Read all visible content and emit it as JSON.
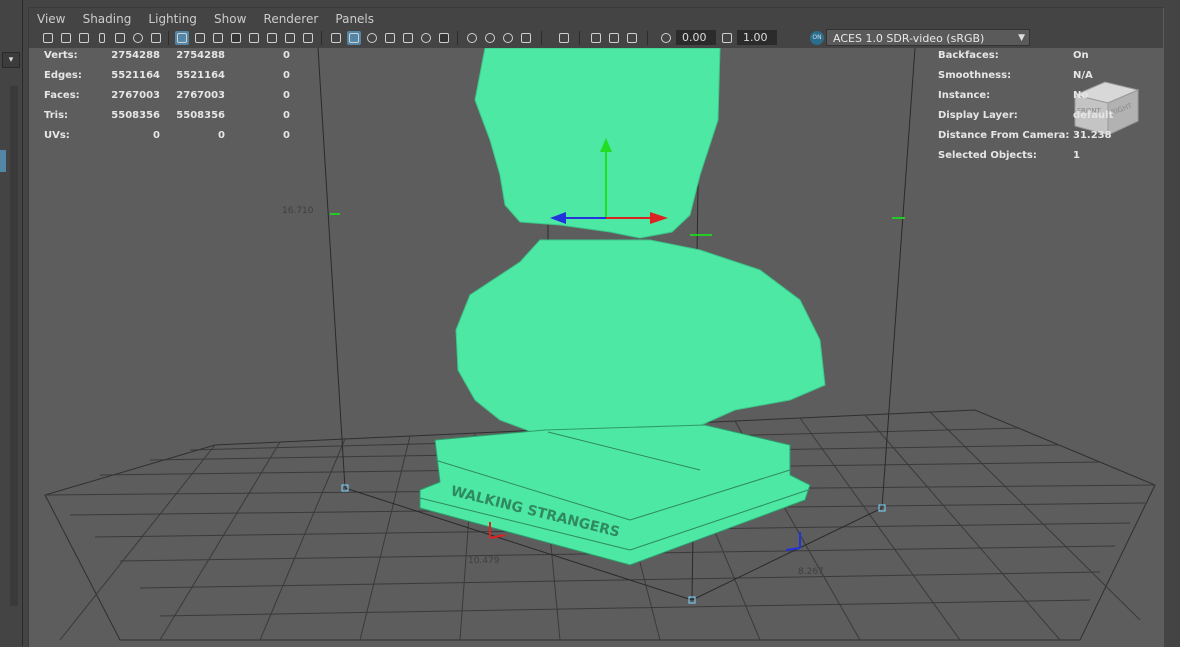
{
  "menu": [
    "View",
    "Shading",
    "Lighting",
    "Show",
    "Renderer",
    "Panels"
  ],
  "toolbar": {
    "exposure": "0.00",
    "gamma": "1.00",
    "color_management_label": "ON",
    "color_space": "ACES 1.0 SDR-video (sRGB)"
  },
  "icons": [
    "camera-icon",
    "camera-lock-icon",
    "bookmark-icon",
    "image-plane-icon",
    "grid-icon",
    "film-gate-icon",
    "resolution-gate-icon",
    "wireframe-icon",
    "smooth-shade-icon",
    "texture-icon",
    "lighting-icon",
    "shadows-icon",
    "isolate-icon",
    "xray-icon",
    "hud-icon"
  ],
  "hud_left": {
    "rows": [
      {
        "label": "Verts:",
        "a": "2754288",
        "b": "2754288",
        "c": "0"
      },
      {
        "label": "Edges:",
        "a": "5521164",
        "b": "5521164",
        "c": "0"
      },
      {
        "label": "Faces:",
        "a": "2767003",
        "b": "2767003",
        "c": "0"
      },
      {
        "label": "Tris:",
        "a": "5508356",
        "b": "5508356",
        "c": "0"
      },
      {
        "label": "UVs:",
        "a": "0",
        "b": "0",
        "c": "0"
      }
    ]
  },
  "hud_right": {
    "rows": [
      {
        "label": "Backfaces:",
        "value": "On"
      },
      {
        "label": "Smoothness:",
        "value": "N/A"
      },
      {
        "label": "Instance:",
        "value": "No"
      },
      {
        "label": "Display Layer:",
        "value": "default"
      },
      {
        "label": "Distance From Camera:",
        "value": "31.238"
      },
      {
        "label": "Selected Objects:",
        "value": "1"
      }
    ]
  },
  "viewcube": {
    "front": "FRONT",
    "right": "RIGHT"
  },
  "dimensions": {
    "height": "16.710",
    "width": "10.479",
    "depth": "8.267"
  },
  "model_text": "WALKING STRANGERS",
  "colors": {
    "model": "#4de8a3",
    "viewport": "#5d5d5d",
    "accent": "#5285a6"
  }
}
